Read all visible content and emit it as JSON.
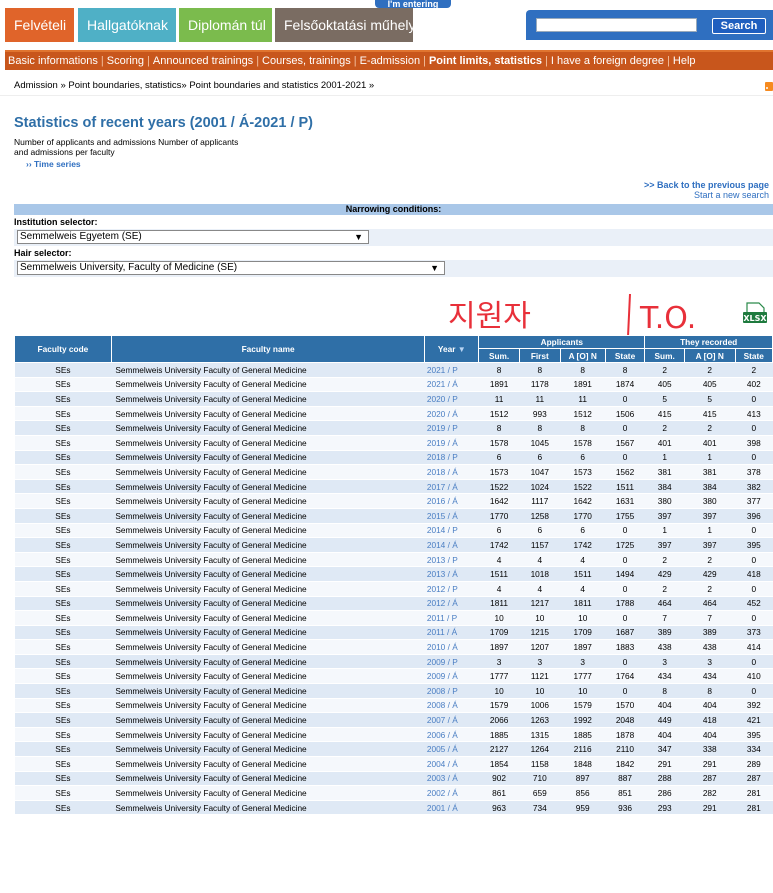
{
  "top_tab": "I'm entering",
  "tabs": [
    "Felvételi",
    "Hallgatóknak",
    "Diplomán túl",
    "Felsőoktatási műhely"
  ],
  "search": {
    "button": "Search",
    "value": ""
  },
  "nav": [
    {
      "label": "Basic informations",
      "active": false
    },
    {
      "label": "Scoring",
      "active": false
    },
    {
      "label": "Announced trainings",
      "active": false
    },
    {
      "label": "Courses, trainings",
      "active": false
    },
    {
      "label": "E-admission",
      "active": false
    },
    {
      "label": "Point limits, statistics",
      "active": true
    },
    {
      "label": "I have a foreign degree",
      "active": false
    },
    {
      "label": "Help",
      "active": false
    }
  ],
  "breadcrumb": [
    "Admission",
    "Point boundaries, statistics",
    "Point boundaries and statistics 2001-2021"
  ],
  "page": {
    "title": "Statistics of recent years (2001 / Á-2021 / P)",
    "subtitle": "Number of applicants and admissions Number of applicants and admissions per faculty",
    "time_series": "›› Time series",
    "back_link": ">> Back to the previous page",
    "new_search": "Start a new search"
  },
  "filters": {
    "heading": "Narrowing conditions:",
    "institution_label": "Institution selector:",
    "institution_value": "Semmelweis Egyetem (SE)",
    "hair_label": "Hair selector:",
    "hair_value": "Semmelweis University, Faculty of Medicine (SE)"
  },
  "table": {
    "headers": {
      "faculty_code": "Faculty code",
      "faculty_name": "Faculty name",
      "year": "Year",
      "applicants": "Applicants",
      "recorded": "They recorded",
      "sum": "Sum.",
      "first": "First",
      "aon": "A [O] N",
      "state": "State"
    },
    "rows": [
      [
        "SEs",
        "Semmelweis University Faculty of General Medicine",
        "2021 / P",
        "8",
        "8",
        "8",
        "8",
        "2",
        "2",
        "2"
      ],
      [
        "SEs",
        "Semmelweis University Faculty of General Medicine",
        "2021 / Á",
        "1891",
        "1178",
        "1891",
        "1874",
        "405",
        "405",
        "402"
      ],
      [
        "SEs",
        "Semmelweis University Faculty of General Medicine",
        "2020 / P",
        "11",
        "11",
        "11",
        "0",
        "5",
        "5",
        "0"
      ],
      [
        "SEs",
        "Semmelweis University Faculty of General Medicine",
        "2020 / Á",
        "1512",
        "993",
        "1512",
        "1506",
        "415",
        "415",
        "413"
      ],
      [
        "SEs",
        "Semmelweis University Faculty of General Medicine",
        "2019 / P",
        "8",
        "8",
        "8",
        "0",
        "2",
        "2",
        "0"
      ],
      [
        "SEs",
        "Semmelweis University Faculty of General Medicine",
        "2019 / Á",
        "1578",
        "1045",
        "1578",
        "1567",
        "401",
        "401",
        "398"
      ],
      [
        "SEs",
        "Semmelweis University Faculty of General Medicine",
        "2018 / P",
        "6",
        "6",
        "6",
        "0",
        "1",
        "1",
        "0"
      ],
      [
        "SEs",
        "Semmelweis University Faculty of General Medicine",
        "2018 / Á",
        "1573",
        "1047",
        "1573",
        "1562",
        "381",
        "381",
        "378"
      ],
      [
        "SEs",
        "Semmelweis University Faculty of General Medicine",
        "2017 / Á",
        "1522",
        "1024",
        "1522",
        "1511",
        "384",
        "384",
        "382"
      ],
      [
        "SEs",
        "Semmelweis University Faculty of General Medicine",
        "2016 / Á",
        "1642",
        "1117",
        "1642",
        "1631",
        "380",
        "380",
        "377"
      ],
      [
        "SEs",
        "Semmelweis University Faculty of General Medicine",
        "2015 / Á",
        "1770",
        "1258",
        "1770",
        "1755",
        "397",
        "397",
        "396"
      ],
      [
        "SEs",
        "Semmelweis University Faculty of General Medicine",
        "2014 / P",
        "6",
        "6",
        "6",
        "0",
        "1",
        "1",
        "0"
      ],
      [
        "SEs",
        "Semmelweis University Faculty of General Medicine",
        "2014 / Á",
        "1742",
        "1157",
        "1742",
        "1725",
        "397",
        "397",
        "395"
      ],
      [
        "SEs",
        "Semmelweis University Faculty of General Medicine",
        "2013 / P",
        "4",
        "4",
        "4",
        "0",
        "2",
        "2",
        "0"
      ],
      [
        "SEs",
        "Semmelweis University Faculty of General Medicine",
        "2013 / Á",
        "1511",
        "1018",
        "1511",
        "1494",
        "429",
        "429",
        "418"
      ],
      [
        "SEs",
        "Semmelweis University Faculty of General Medicine",
        "2012 / P",
        "4",
        "4",
        "4",
        "0",
        "2",
        "2",
        "0"
      ],
      [
        "SEs",
        "Semmelweis University Faculty of General Medicine",
        "2012 / Á",
        "1811",
        "1217",
        "1811",
        "1788",
        "464",
        "464",
        "452"
      ],
      [
        "SEs",
        "Semmelweis University Faculty of General Medicine",
        "2011 / P",
        "10",
        "10",
        "10",
        "0",
        "7",
        "7",
        "0"
      ],
      [
        "SEs",
        "Semmelweis University Faculty of General Medicine",
        "2011 / Á",
        "1709",
        "1215",
        "1709",
        "1687",
        "389",
        "389",
        "373"
      ],
      [
        "SEs",
        "Semmelweis University Faculty of General Medicine",
        "2010 / Á",
        "1897",
        "1207",
        "1897",
        "1883",
        "438",
        "438",
        "414"
      ],
      [
        "SEs",
        "Semmelweis University Faculty of General Medicine",
        "2009 / P",
        "3",
        "3",
        "3",
        "0",
        "3",
        "3",
        "0"
      ],
      [
        "SEs",
        "Semmelweis University Faculty of General Medicine",
        "2009 / Á",
        "1777",
        "1121",
        "1777",
        "1764",
        "434",
        "434",
        "410"
      ],
      [
        "SEs",
        "Semmelweis University Faculty of General Medicine",
        "2008 / P",
        "10",
        "10",
        "10",
        "0",
        "8",
        "8",
        "0"
      ],
      [
        "SEs",
        "Semmelweis University Faculty of General Medicine",
        "2008 / Á",
        "1579",
        "1006",
        "1579",
        "1570",
        "404",
        "404",
        "392"
      ],
      [
        "SEs",
        "Semmelweis University Faculty of General Medicine",
        "2007 / Á",
        "2066",
        "1263",
        "1992",
        "2048",
        "449",
        "418",
        "421"
      ],
      [
        "SEs",
        "Semmelweis University Faculty of General Medicine",
        "2006 / Á",
        "1885",
        "1315",
        "1885",
        "1878",
        "404",
        "404",
        "395"
      ],
      [
        "SEs",
        "Semmelweis University Faculty of General Medicine",
        "2005 / Á",
        "2127",
        "1264",
        "2116",
        "2110",
        "347",
        "338",
        "334"
      ],
      [
        "SEs",
        "Semmelweis University Faculty of General Medicine",
        "2004 / Á",
        "1854",
        "1158",
        "1848",
        "1842",
        "291",
        "291",
        "289"
      ],
      [
        "SEs",
        "Semmelweis University Faculty of General Medicine",
        "2003 / Á",
        "902",
        "710",
        "897",
        "887",
        "288",
        "287",
        "287"
      ],
      [
        "SEs",
        "Semmelweis University Faculty of General Medicine",
        "2002 / Á",
        "861",
        "659",
        "856",
        "851",
        "286",
        "282",
        "281"
      ],
      [
        "SEs",
        "Semmelweis University Faculty of General Medicine",
        "2001 / Á",
        "963",
        "734",
        "959",
        "936",
        "293",
        "291",
        "281"
      ]
    ]
  },
  "annotations": {
    "handwriting_left": "지원자",
    "handwriting_right": "T.O.",
    "export_icon": "xlsx-icon",
    "export_label": "XLSX"
  }
}
